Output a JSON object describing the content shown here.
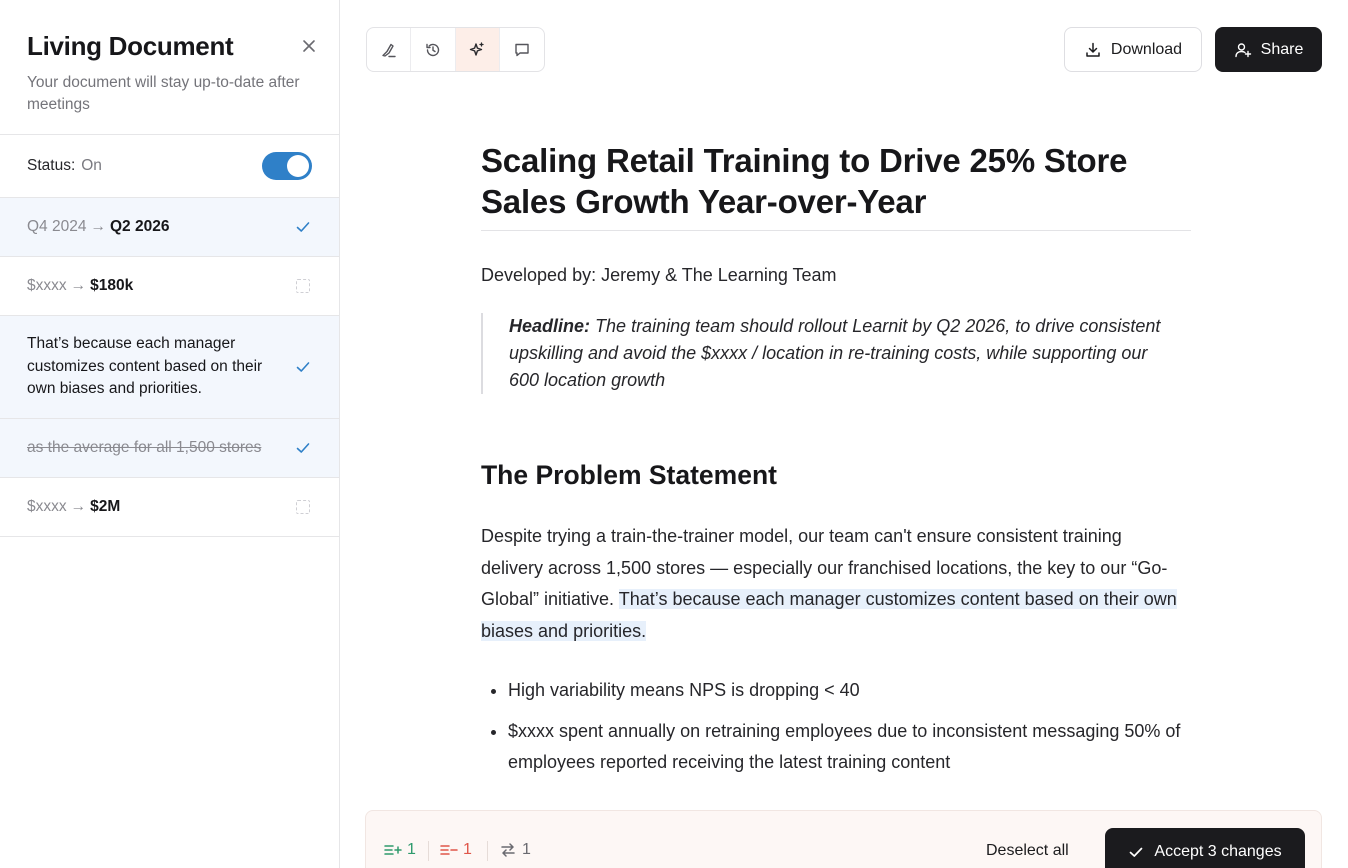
{
  "sidebar": {
    "title": "Living Document",
    "subtitle": "Your document will stay up-to-date after meetings",
    "status_label": "Status:",
    "status_value": "On",
    "changes": [
      {
        "old": "Q4 2024",
        "new": "Q2 2026",
        "selected": true
      },
      {
        "old": "$xxxx",
        "new": "$180k",
        "selected": false
      },
      {
        "text": "That’s because each manager customizes content based on their own biases and priorities.",
        "selected": true
      },
      {
        "removed": "as the average for all 1,500 stores",
        "selected": true
      },
      {
        "old": "$xxxx",
        "new": "$2M",
        "selected": false
      }
    ]
  },
  "toolbar": {
    "tools": [
      "brush-icon",
      "history-icon",
      "sparkle-icon",
      "comment-icon"
    ],
    "download_label": "Download",
    "share_label": "Share"
  },
  "document": {
    "title": "Scaling Retail Training to Drive 25% Store Sales Growth Year-over-Year",
    "developed_by": "Developed by: Jeremy & The Learning Team",
    "headline_label": "Headline:",
    "headline_text": "The training team should rollout Learnit by Q2 2026, to drive consistent upskilling and avoid the $xxxx / location in re-training costs, while supporting our 600 location growth",
    "section_title": "The Problem Statement",
    "para_text": "Despite trying a train-the-trainer model, our team can't ensure consistent training delivery across 1,500 stores — especially our franchised locations, the key to our “Go-Global” initiative.",
    "para_highlight": "That’s because each manager customizes content based on their own biases and priorities.",
    "bullets": [
      "High variability means NPS is dropping < 40",
      "$xxxx spent annually on retraining employees due to inconsistent messaging 50% of employees reported receiving the latest training content"
    ]
  },
  "changes_bar": {
    "added_count": "1",
    "removed_count": "1",
    "modified_count": "1",
    "deselect_label": "Deselect all",
    "accept_label": "Accept 3 changes"
  },
  "colors": {
    "accent": "#2f80c8",
    "selected_row": "#f3f7fd",
    "highlight": "#e7f0fb",
    "added": "#2e9a6d",
    "removed": "#e0564a",
    "dark_button": "#1b1b1e"
  }
}
